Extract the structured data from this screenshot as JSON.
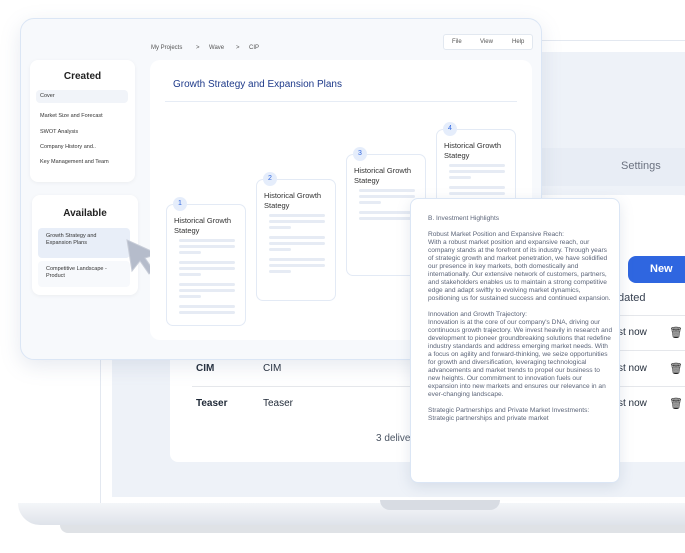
{
  "background_app": {
    "tab": "Settings",
    "new_button": "New",
    "column_header_fragment": "dated",
    "rows": [
      {
        "name": "",
        "type": "",
        "time": "st now"
      },
      {
        "name": "CIM",
        "type": "CIM",
        "time": "st now"
      },
      {
        "name": "Teaser",
        "type": "Teaser",
        "time": "st now"
      }
    ],
    "count_fragment": "3 delive"
  },
  "window": {
    "breadcrumb": [
      "My Projects",
      "Wave",
      "CIP"
    ],
    "menu": [
      "File",
      "View",
      "Help"
    ],
    "created": {
      "title": "Created",
      "items": [
        "Cover",
        "Market Size and Forecast",
        "SWOT Analysis",
        "Company History and..",
        "Key Management and Team"
      ]
    },
    "available": {
      "title": "Available",
      "items": [
        "Growth Strategy and Expansion Plans",
        "Competitive Landscape - Product"
      ]
    },
    "main_title": "Growth Strategy and Expansion Plans",
    "steps": [
      {
        "num": "1",
        "title": "Historical Growth Stategy"
      },
      {
        "num": "2",
        "title": "Historical Growth Stategy"
      },
      {
        "num": "3",
        "title": "Historical Growth Stategy"
      },
      {
        "num": "4",
        "title": "Historical Growth Stategy"
      }
    ]
  },
  "popup": {
    "heading": "B. Investment Highlights",
    "paragraphs": [
      "Robust Market Position and Expansive Reach:\nWith a robust market position and expansive reach, our company stands at the forefront of its industry. Through years of strategic growth and market penetration, we have solidified our presence in key markets, both domestically and internationally. Our extensive network of customers, partners, and stakeholders enables us to maintain a strong competitive edge and adapt swiftly to evolving market dynamics, positioning us for sustained success and continued expansion.",
      "Innovation and Growth Trajectory:\nInnovation is at the core of our company's DNA, driving our continuous growth trajectory. We invest heavily in research and development to pioneer groundbreaking solutions that redefine industry standards and address emerging market needs. With a focus on agility and forward-thinking, we seize opportunities for growth and diversification, leveraging technological advancements and market trends to propel our business to new heights. Our commitment to innovation fuels our expansion into new markets and ensures our relevance in an ever-changing landscape.",
      "Strategic Partnerships and Private Market Investments:\nStrategic partnerships and private market"
    ]
  },
  "colors": {
    "accent": "#2f66e0",
    "title": "#1e3a8a",
    "screen_bg": "#eef2f8"
  }
}
